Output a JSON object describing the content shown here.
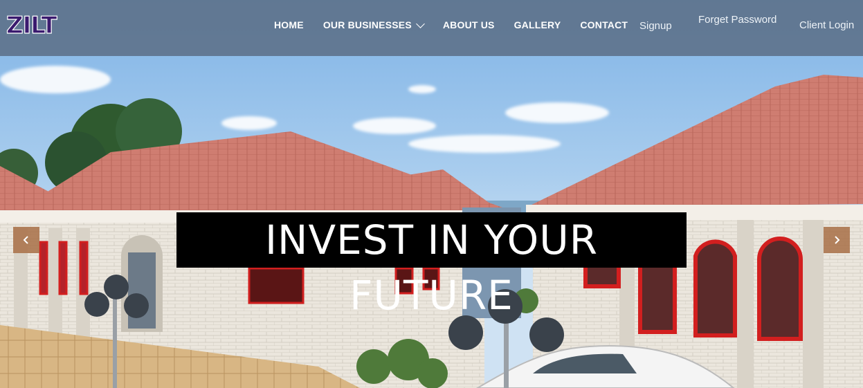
{
  "brand": {
    "logo_text": "ZILT"
  },
  "nav": {
    "main": [
      {
        "label": "HOME"
      },
      {
        "label": "OUR BUSINESSES",
        "has_dropdown": true
      },
      {
        "label": "ABOUT US"
      },
      {
        "label": "GALLERY"
      },
      {
        "label": "CONTACT"
      }
    ],
    "aux": {
      "signup": "Signup",
      "forget_password": "Forget Password",
      "client_login": "Client Login"
    }
  },
  "hero": {
    "headline": "INVEST IN YOUR FUTURE",
    "prev_icon": "chevron-left-icon",
    "next_icon": "chevron-right-icon"
  },
  "colors": {
    "navbar_bg": "#5c7088",
    "logo_fill": "#3a1a6e",
    "arrow_bg": "#a86e46",
    "headline_bg": "#000000",
    "roof": "#c9766a",
    "wall": "#ece7de",
    "window_frame": "#d21f1f"
  }
}
